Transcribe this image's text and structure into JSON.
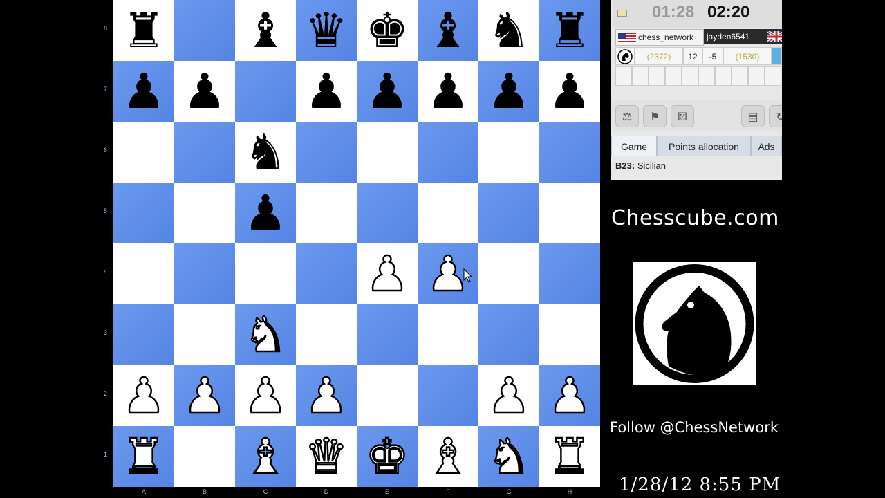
{
  "board": {
    "ranks": [
      "8",
      "7",
      "6",
      "5",
      "4",
      "3",
      "2",
      "1"
    ],
    "files": [
      "A",
      "B",
      "C",
      "D",
      "E",
      "F",
      "G",
      "H"
    ],
    "position": [
      [
        "r",
        "",
        "b",
        "q",
        "k",
        "b",
        "n",
        "r"
      ],
      [
        "p",
        "p",
        "",
        "p",
        "p",
        "p",
        "p",
        "p"
      ],
      [
        "",
        "",
        "n",
        "",
        "",
        "",
        "",
        ""
      ],
      [
        "",
        "",
        "p",
        "",
        "",
        "",
        "",
        ""
      ],
      [
        "",
        "",
        "",
        "",
        "P",
        "P",
        "",
        ""
      ],
      [
        "",
        "",
        "N",
        "",
        "",
        "",
        "",
        ""
      ],
      [
        "P",
        "P",
        "P",
        "P",
        "",
        "",
        "P",
        "P"
      ],
      [
        "R",
        "",
        "B",
        "Q",
        "K",
        "B",
        "N",
        "R"
      ]
    ],
    "colors": {
      "light": "#ffffff",
      "dark": "#5f8fea"
    }
  },
  "clocks": {
    "left": "01:28",
    "right": "02:20"
  },
  "players": {
    "left": {
      "name": "chess_network",
      "rating": "(2372)",
      "flag": "us-flag"
    },
    "right": {
      "name": "jayden6541",
      "rating": "(1530)",
      "flag": "uk-flag"
    },
    "points_left": "12",
    "points_right": "-5"
  },
  "tabs": [
    "Game",
    "Points allocation",
    "Ads"
  ],
  "opening": {
    "code": "B23:",
    "name": "Sicilian"
  },
  "promo": {
    "site": "Chesscube.com",
    "follow": "Follow @ChessNetwork",
    "datetime": "1/28/12 8:55 PM"
  },
  "icons": {
    "toolbar": [
      "handshake-icon",
      "flag-icon",
      "dice-icon",
      "save-icon",
      "refresh-icon"
    ],
    "logo": "knight-logo-icon"
  }
}
